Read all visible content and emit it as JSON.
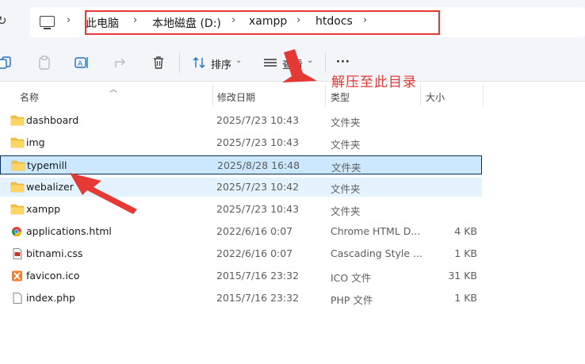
{
  "address": {
    "crumbs": [
      "此电脑",
      "本地磁盘 (D:)",
      "xampp",
      "htdocs"
    ]
  },
  "toolbar": {
    "sort_label": "排序",
    "view_label": "查看",
    "more_label": "···"
  },
  "columns": {
    "name": "名称",
    "date": "修改日期",
    "type": "类型",
    "size": "大小"
  },
  "files": [
    {
      "name": "dashboard",
      "date": "2025/7/23 10:43",
      "type": "文件夹",
      "size": "",
      "icon": "folder-icon"
    },
    {
      "name": "img",
      "date": "2025/7/23 10:43",
      "type": "文件夹",
      "size": "",
      "icon": "folder-icon"
    },
    {
      "name": "typemill",
      "date": "2025/8/28 16:48",
      "type": "文件夹",
      "size": "",
      "icon": "folder-icon",
      "selected": true
    },
    {
      "name": "webalizer",
      "date": "2025/7/23 10:42",
      "type": "文件夹",
      "size": "",
      "icon": "folder-icon",
      "hover": true
    },
    {
      "name": "xampp",
      "date": "2025/7/23 10:43",
      "type": "文件夹",
      "size": "",
      "icon": "folder-icon"
    },
    {
      "name": "applications.html",
      "date": "2022/6/16 0:07",
      "type": "Chrome HTML D...",
      "size": "4 KB",
      "icon": "chrome-html-icon"
    },
    {
      "name": "bitnami.css",
      "date": "2022/6/16 0:07",
      "type": "Cascading Style ...",
      "size": "1 KB",
      "icon": "css-file-icon"
    },
    {
      "name": "favicon.ico",
      "date": "2015/7/16 23:32",
      "type": "ICO 文件",
      "size": "31 KB",
      "icon": "xampp-ico-icon"
    },
    {
      "name": "index.php",
      "date": "2015/7/16 23:32",
      "type": "PHP 文件",
      "size": "1 KB",
      "icon": "blank-file-icon"
    }
  ],
  "annotation": {
    "text": "解压至此目录",
    "color": "#e53935"
  },
  "colors": {
    "selection_bg": "#cce8ff",
    "hover_bg": "#e5f3ff",
    "folder": "#f5c042"
  }
}
